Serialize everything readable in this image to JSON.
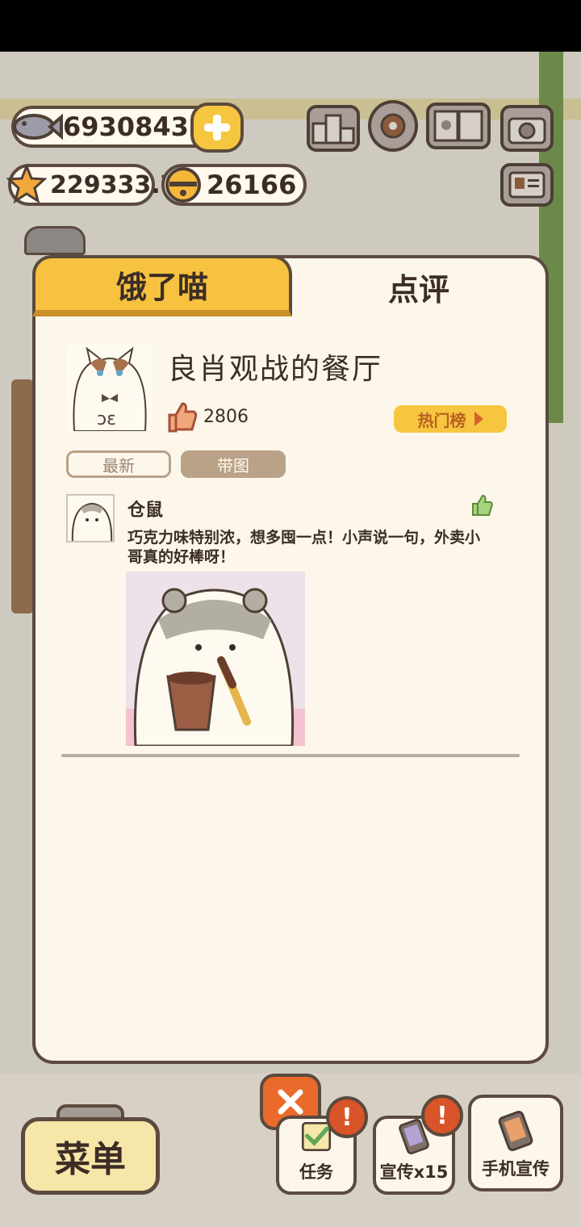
{
  "currency": {
    "fish": "69308438",
    "stars": "229333.7",
    "bells": "26166"
  },
  "tabs": {
    "hungry": "饿了喵",
    "review": "点评"
  },
  "restaurant": {
    "name": "良肖观战的餐厅",
    "likes": "2806",
    "hot_list": "热门榜"
  },
  "filters": {
    "newest": "最新",
    "with_pics": "带图"
  },
  "review": {
    "author": "仓鼠",
    "text": "巧克力味特别浓，想多囤一点！小声说一句，外卖小哥真的好棒呀！"
  },
  "bottom": {
    "menu": "菜单",
    "task": "任务",
    "promo": "宣传x15",
    "phone_promo": "手机宣传",
    "badge": "!"
  },
  "colors": {
    "accent_yellow": "#f6c240",
    "outline_brown": "#5b4a3d",
    "panel_bg": "#fdf6ea",
    "close_orange": "#ea6a2b"
  },
  "icons": [
    "fish-icon",
    "star-icon",
    "bell-icon",
    "plus-icon",
    "ranking-icon",
    "gear-icon",
    "book-icon",
    "camera-icon",
    "card-icon",
    "thumbs-up-icon",
    "close-icon",
    "check-icon",
    "phone-icon"
  ]
}
